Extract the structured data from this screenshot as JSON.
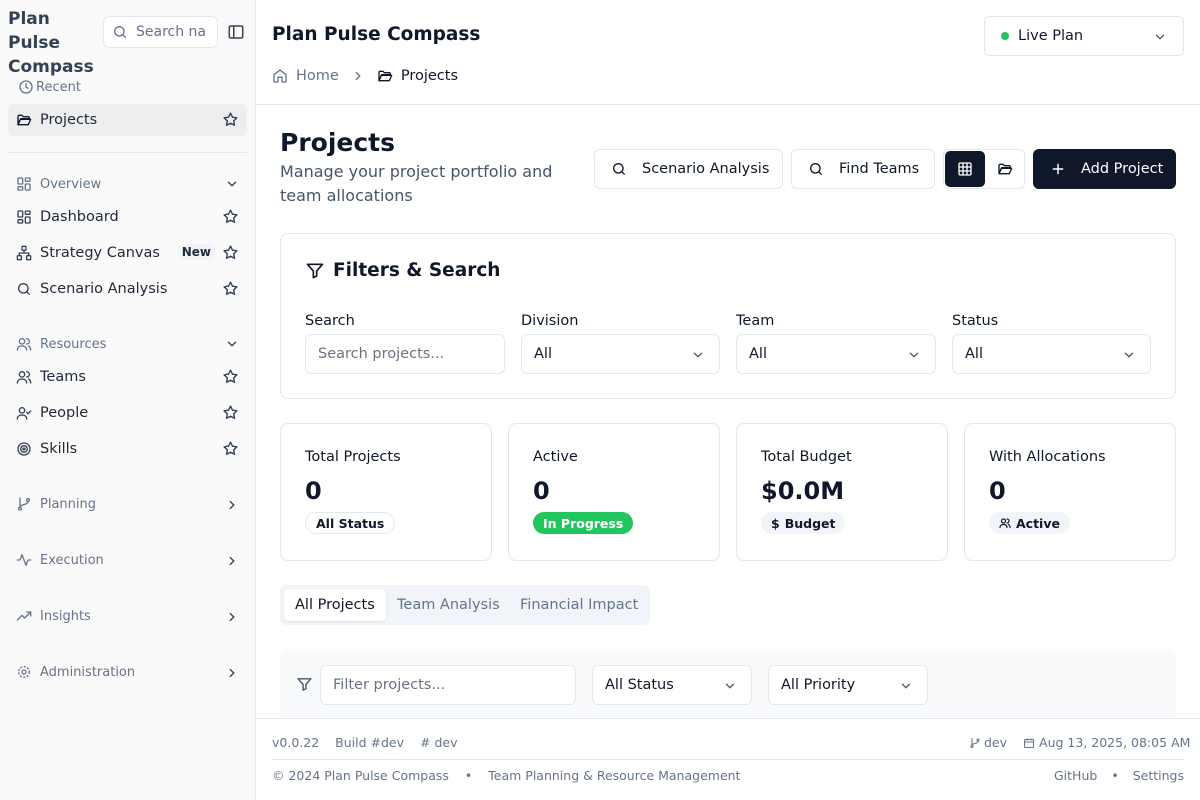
{
  "sidebar": {
    "brand": "Plan Pulse Compass",
    "search_placeholder": "Search na",
    "recent_label": "Recent",
    "recent_items": [
      {
        "label": "Projects",
        "icon": "folder-open-icon"
      }
    ],
    "sections": [
      {
        "label": "Overview",
        "icon": "layout-grid-icon",
        "expanded": true
      },
      {
        "label": "Resources",
        "icon": "users-icon",
        "expanded": true
      },
      {
        "label": "Planning",
        "icon": "git-branch-icon",
        "expanded": false
      },
      {
        "label": "Execution",
        "icon": "activity-icon",
        "expanded": false
      },
      {
        "label": "Insights",
        "icon": "trending-up-icon",
        "expanded": false
      },
      {
        "label": "Administration",
        "icon": "gear-icon",
        "expanded": false
      }
    ],
    "overview_items": [
      {
        "label": "Dashboard",
        "icon": "layout-grid-icon"
      },
      {
        "label": "Strategy Canvas",
        "icon": "network-icon",
        "badge": "New"
      },
      {
        "label": "Scenario Analysis",
        "icon": "search-icon"
      }
    ],
    "resources_items": [
      {
        "label": "Teams",
        "icon": "users-icon"
      },
      {
        "label": "People",
        "icon": "user-check-icon"
      },
      {
        "label": "Skills",
        "icon": "target-icon"
      }
    ]
  },
  "header": {
    "title": "Plan Pulse Compass",
    "plan_select": "Live Plan",
    "plan_status_color": "#22c55e",
    "breadcrumb": [
      "Home",
      "Projects"
    ]
  },
  "page": {
    "title": "Projects",
    "subtitle": "Manage your project portfolio and team allocations",
    "actions": {
      "scenario": "Scenario Analysis",
      "find_teams": "Find Teams",
      "add_project": "Add Project"
    }
  },
  "filters": {
    "title": "Filters & Search",
    "search_label": "Search",
    "search_placeholder": "Search projects...",
    "division_label": "Division",
    "division_value": "All",
    "team_label": "Team",
    "team_value": "All",
    "status_label": "Status",
    "status_value": "All"
  },
  "stats": [
    {
      "title": "Total Projects",
      "value": "0",
      "badge": "All Status"
    },
    {
      "title": "Active",
      "value": "0",
      "badge": "In Progress",
      "badge_color": "#22c55e"
    },
    {
      "title": "Total Budget",
      "value": "$0.0M",
      "badge": "Budget"
    },
    {
      "title": "With Allocations",
      "value": "0",
      "badge": "Active"
    }
  ],
  "tabs": [
    "All Projects",
    "Team Analysis",
    "Financial Impact"
  ],
  "table_filters": {
    "filter_placeholder": "Filter projects...",
    "status": "All Status",
    "priority": "All Priority"
  },
  "footer": {
    "version": "v0.0.22",
    "build": "Build #dev",
    "hash": "dev",
    "branch": "dev",
    "datetime": "Aug 13, 2025, 08:05 AM",
    "copyright": "© 2024 Plan Pulse Compass",
    "bullet": "•",
    "tagline": "Team Planning & Resource Management",
    "github": "GitHub",
    "settings": "Settings"
  },
  "colors": {
    "accent": "#0f172a",
    "success": "#22c55e"
  }
}
